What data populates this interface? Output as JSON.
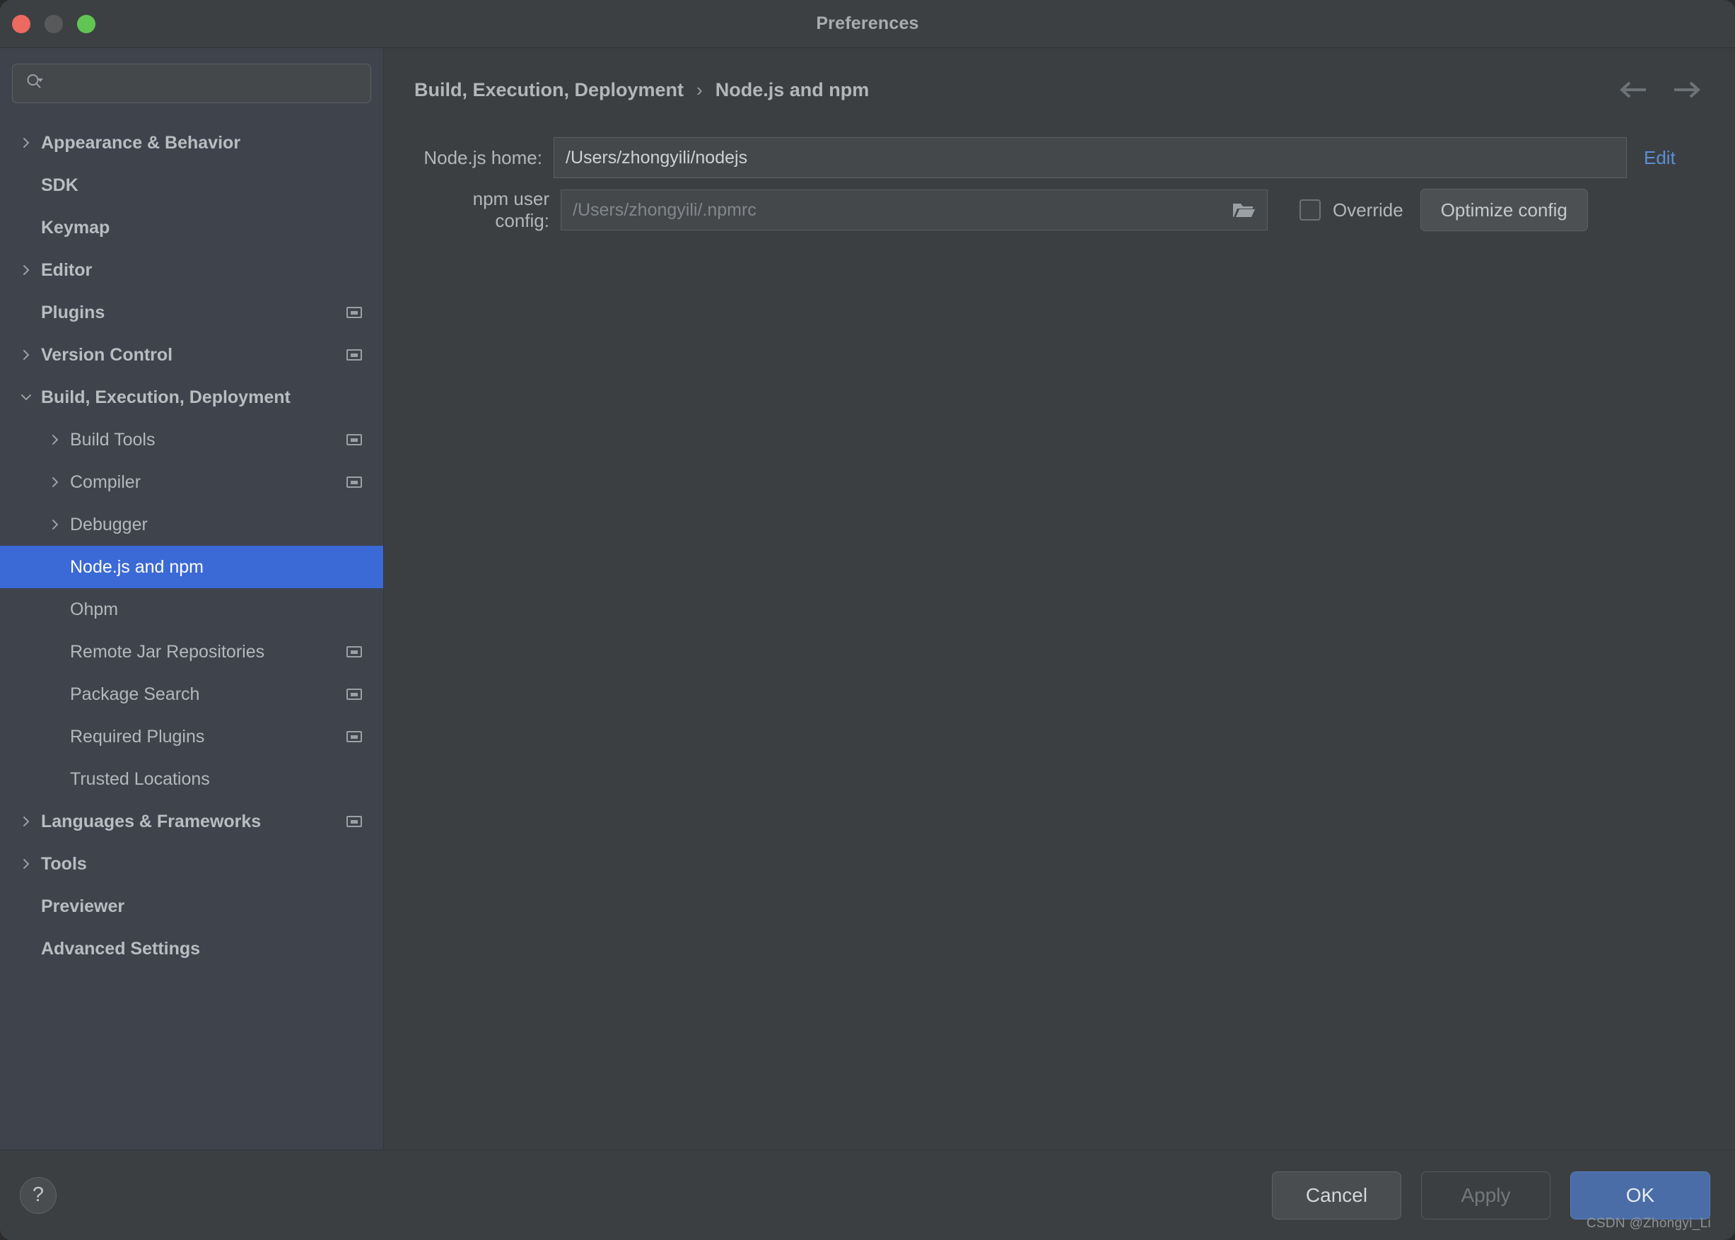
{
  "window": {
    "title": "Preferences",
    "traffic_lights": [
      "close",
      "minimize",
      "maximize"
    ]
  },
  "sidebar": {
    "search": {
      "value": "",
      "placeholder": ""
    },
    "items": [
      {
        "label": "Appearance & Behavior",
        "level": 0,
        "twisty": "right",
        "bold": true,
        "badge": false,
        "selected": false
      },
      {
        "label": "SDK",
        "level": 0,
        "twisty": "none",
        "bold": true,
        "badge": false,
        "selected": false
      },
      {
        "label": "Keymap",
        "level": 0,
        "twisty": "none",
        "bold": true,
        "badge": false,
        "selected": false
      },
      {
        "label": "Editor",
        "level": 0,
        "twisty": "right",
        "bold": true,
        "badge": false,
        "selected": false
      },
      {
        "label": "Plugins",
        "level": 0,
        "twisty": "none",
        "bold": true,
        "badge": true,
        "selected": false
      },
      {
        "label": "Version Control",
        "level": 0,
        "twisty": "right",
        "bold": true,
        "badge": true,
        "selected": false
      },
      {
        "label": "Build, Execution, Deployment",
        "level": 0,
        "twisty": "down",
        "bold": true,
        "badge": false,
        "selected": false
      },
      {
        "label": "Build Tools",
        "level": 1,
        "twisty": "right",
        "bold": false,
        "badge": true,
        "selected": false
      },
      {
        "label": "Compiler",
        "level": 1,
        "twisty": "right",
        "bold": false,
        "badge": true,
        "selected": false
      },
      {
        "label": "Debugger",
        "level": 1,
        "twisty": "right",
        "bold": false,
        "badge": false,
        "selected": false
      },
      {
        "label": "Node.js and npm",
        "level": 1,
        "twisty": "none",
        "bold": false,
        "badge": false,
        "selected": true
      },
      {
        "label": "Ohpm",
        "level": 1,
        "twisty": "none",
        "bold": false,
        "badge": false,
        "selected": false
      },
      {
        "label": "Remote Jar Repositories",
        "level": 1,
        "twisty": "none",
        "bold": false,
        "badge": true,
        "selected": false
      },
      {
        "label": "Package Search",
        "level": 1,
        "twisty": "none",
        "bold": false,
        "badge": true,
        "selected": false
      },
      {
        "label": "Required Plugins",
        "level": 1,
        "twisty": "none",
        "bold": false,
        "badge": true,
        "selected": false
      },
      {
        "label": "Trusted Locations",
        "level": 1,
        "twisty": "none",
        "bold": false,
        "badge": false,
        "selected": false
      },
      {
        "label": "Languages & Frameworks",
        "level": 0,
        "twisty": "right",
        "bold": true,
        "badge": true,
        "selected": false
      },
      {
        "label": "Tools",
        "level": 0,
        "twisty": "right",
        "bold": true,
        "badge": false,
        "selected": false
      },
      {
        "label": "Previewer",
        "level": 0,
        "twisty": "none",
        "bold": true,
        "badge": false,
        "selected": false
      },
      {
        "label": "Advanced Settings",
        "level": 0,
        "twisty": "none",
        "bold": true,
        "badge": false,
        "selected": false
      }
    ]
  },
  "main": {
    "breadcrumb": {
      "parent": "Build, Execution, Deployment",
      "separator": "›",
      "current": "Node.js and npm"
    },
    "nav": {
      "back": "back-arrow-icon",
      "forward": "forward-arrow-icon"
    },
    "node_home": {
      "label": "Node.js home:",
      "value": "/Users/zhongyili/nodejs",
      "placeholder": "",
      "edit_link": "Edit"
    },
    "npm_user_config": {
      "label": "npm user config:",
      "value": "",
      "placeholder": "/Users/zhongyili/.npmrc",
      "browse_icon": "folder-icon"
    },
    "override": {
      "label": "Override",
      "checked": false
    },
    "optimize_button": {
      "label": "Optimize config"
    }
  },
  "footer": {
    "help": "?",
    "cancel": "Cancel",
    "apply": "Apply",
    "ok": "OK",
    "watermark": "CSDN @Zhongyi_Li"
  },
  "colors": {
    "window_bg": "#3c3f41",
    "sidebar_bg": "#3f434c",
    "selection": "#3b69d6",
    "accent_link": "#5b8fd6",
    "primary_button": "#4a6da7",
    "text": "#b3b7ba"
  }
}
